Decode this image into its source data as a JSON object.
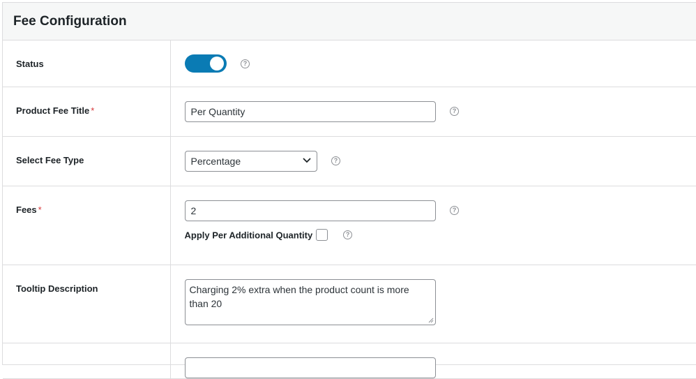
{
  "section": {
    "title": "Fee Configuration"
  },
  "rows": {
    "status": {
      "label": "Status",
      "enabled": true
    },
    "title": {
      "label": "Product Fee Title",
      "required": "*",
      "value": "Per Quantity"
    },
    "fee_type": {
      "label": "Select Fee Type",
      "value": "Percentage"
    },
    "fees": {
      "label": "Fees",
      "required": "*",
      "value": "2",
      "additional_label": "Apply Per Additional Quantity",
      "additional_checked": false
    },
    "tooltip": {
      "label": "Tooltip Description",
      "value": "Charging 2% extra when the product count is more than 20"
    }
  },
  "icons": {
    "help": "question-circle-icon",
    "help_glyph": "?"
  },
  "colors": {
    "toggle_on": "#0a7bb4",
    "required": "#d63638",
    "header_bg": "#f6f7f7"
  }
}
